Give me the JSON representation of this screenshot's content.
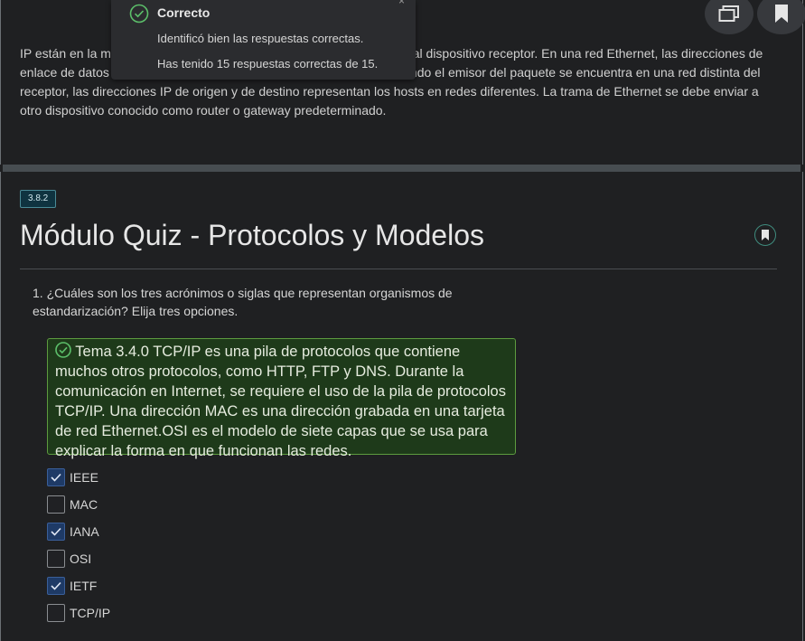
{
  "top": {
    "paragraph": "IP están en la misma red, la trama de Ethernet se envía directamente al dispositivo receptor. En una red Ethernet, las direcciones de enlace de datos se conocen como direcciones MAC de Ethernet. Cuando el emisor del paquete se encuentra en una red distinta del receptor, las direcciones IP de origen y de destino representan los hosts en redes diferentes. La trama de Ethernet se debe enviar a otro dispositivo conocido como router o gateway predeterminado."
  },
  "toast": {
    "title": "Correcto",
    "line1": "Identificó bien las respuestas correctas.",
    "line2": "Has tenido 15 respuestas correctas de 15.",
    "close": "×"
  },
  "section": {
    "badge": "3.8.2",
    "title": "Módulo Quiz - Protocolos y Modelos"
  },
  "question": {
    "number": "1.",
    "text": "¿Cuáles son los tres acrónimos o siglas que representan organismos de estandarización? Elija tres opciones.",
    "feedback": "Tema 3.4.0 TCP/IP es una pila de protocolos que contiene muchos otros protocolos, como HTTP, FTP y DNS. Durante la comunicación en Internet, se requiere el uso de la pila de protocolos TCP/IP. Una dirección MAC es una dirección grabada en una tarjeta de red Ethernet.OSI es el modelo de siete capas que se usa para explicar la forma en que funcionan las redes.",
    "options": [
      {
        "label": "IEEE",
        "checked": true
      },
      {
        "label": "MAC",
        "checked": false
      },
      {
        "label": "IANA",
        "checked": true
      },
      {
        "label": "OSI",
        "checked": false
      },
      {
        "label": "IETF",
        "checked": true
      },
      {
        "label": "TCP/IP",
        "checked": false
      }
    ]
  },
  "colors": {
    "background": "#1f2022",
    "feedback_bg": "#1e3a1a",
    "feedback_border": "#5d9b3f",
    "check_bg": "#1e3a66",
    "success": "#5cbf6a"
  },
  "icons": {
    "toast": "check-circle-icon",
    "feedback": "check-circle-icon",
    "fab_left": "windows-icon",
    "fab_right": "bookmark-icon",
    "section_bookmark": "bookmark-icon"
  }
}
